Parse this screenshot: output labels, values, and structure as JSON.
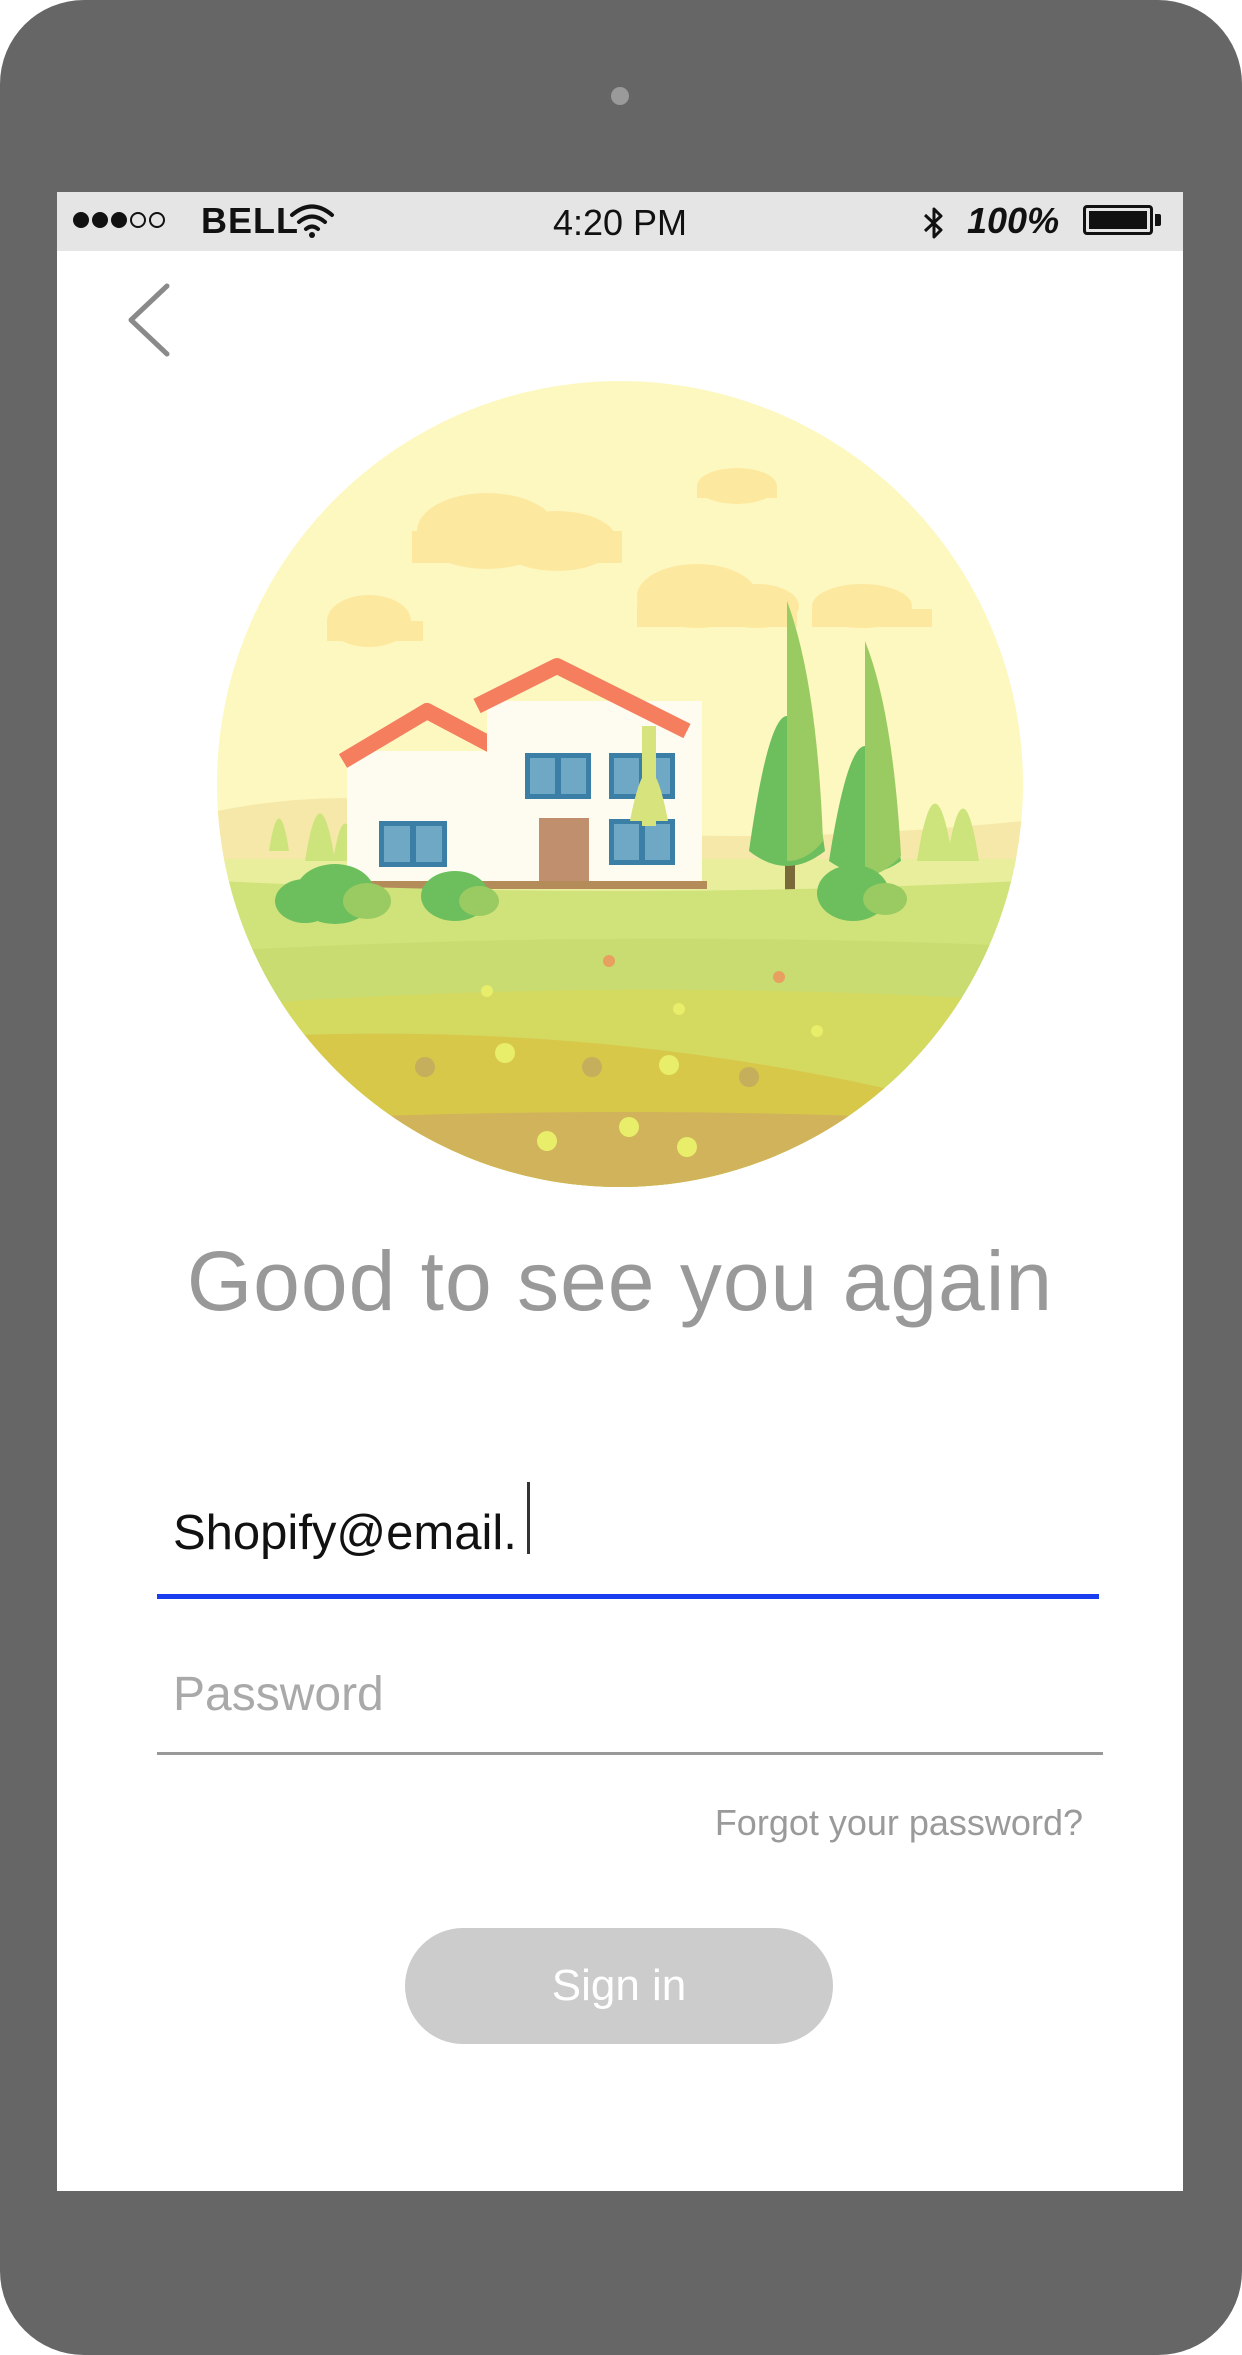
{
  "status_bar": {
    "carrier": "BELL",
    "time": "4:20 PM",
    "battery": "100%",
    "signal_bars_filled": 3,
    "signal_bars_total": 5
  },
  "nav": {
    "back_icon": "chevron-left-icon"
  },
  "illustration": {
    "icon": "house-landscape-illustration"
  },
  "login": {
    "heading": "Good to see you again",
    "email_value": "Shopify@email.",
    "password_placeholder": "Password",
    "forgot_link": "Forgot your password?",
    "signin_label": "Sign in"
  },
  "colors": {
    "device_frame": "#666666",
    "status_bar_bg": "#e5e5e5",
    "active_input_underline": "#1a3df0",
    "button_disabled": "#cccccc",
    "muted_text": "#999999"
  }
}
